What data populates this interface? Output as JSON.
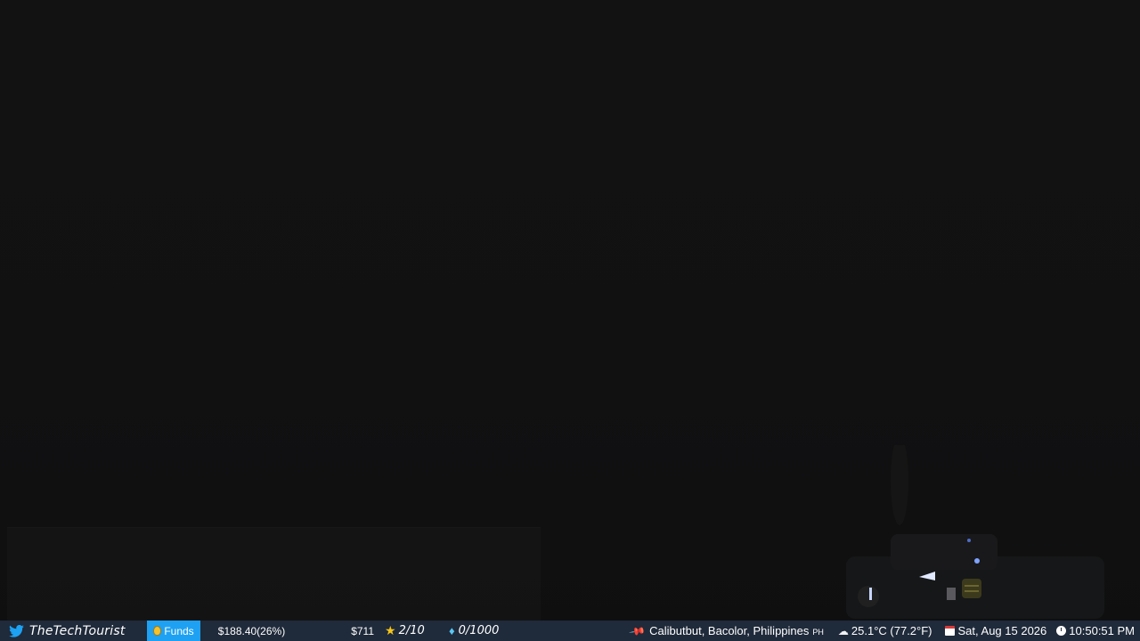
{
  "statusbar": {
    "twitter_handle": "TheTechTourist",
    "funds_label": "Funds",
    "funds_amount": "$188.40(26%)",
    "goal_amount": "$711",
    "stars": "2/10",
    "gems": "0/1000",
    "location": "Calibutbut, Bacolor, Philippines",
    "country_code": "PH",
    "weather": "25.1°C (77.2°F)",
    "date": "Sat, Aug 15 2026",
    "time": "10:50:51 PM"
  },
  "colors": {
    "background": "#111112",
    "statusbar": "#1f2a3a",
    "funds_badge": "#1ea1f2",
    "star": "#f5c518",
    "gem": "#5ac8f5",
    "pin": "#e23b3b"
  },
  "icons": {
    "twitter": "twitter-bird-icon",
    "funds": "money-bag-icon",
    "star": "star-icon",
    "gem": "diamond-icon",
    "location": "pushpin-icon",
    "weather": "cloud-icon",
    "date": "calendar-icon",
    "time": "clock-icon"
  }
}
